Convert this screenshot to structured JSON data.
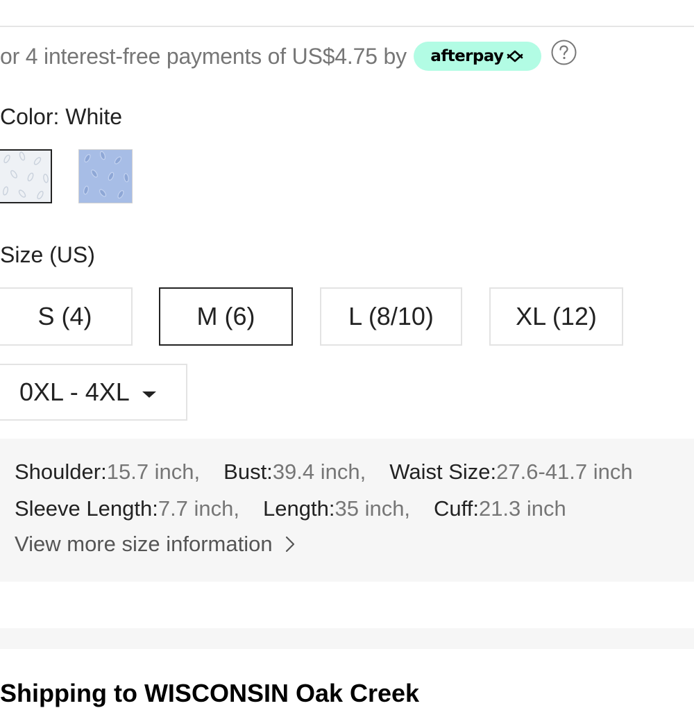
{
  "payment": {
    "installment_text": "or 4 interest-free payments of US$4.75 by",
    "provider_label": "afterpay",
    "provider_color": "#b2fce4",
    "help_icon": "question-circle-icon"
  },
  "color": {
    "label": "Color: White",
    "swatches": [
      {
        "name": "White",
        "selected": true,
        "color": "#f2f4f7"
      },
      {
        "name": "Blue",
        "selected": false,
        "color": "#a9bfe8"
      }
    ]
  },
  "size": {
    "label": "Size (US)",
    "options": [
      {
        "label": "S (4)",
        "selected": false
      },
      {
        "label": "M (6)",
        "selected": true
      },
      {
        "label": "L (8/10)",
        "selected": false
      },
      {
        "label": "XL (12)",
        "selected": false
      }
    ],
    "extended_dropdown": "0XL - 4XL"
  },
  "measurements": {
    "shoulder_key": "Shoulder:",
    "shoulder_val": "15.7 inch,",
    "bust_key": "Bust:",
    "bust_val": "39.4 inch,",
    "waist_key": "Waist Size:",
    "waist_val": "27.6-41.7 inch",
    "sleeve_key": "Sleeve Length:",
    "sleeve_val": "7.7 inch,",
    "length_key": "Length:",
    "length_val": "35 inch,",
    "cuff_key": "Cuff:",
    "cuff_val": "21.3 inch",
    "more_link": "View more size information"
  },
  "shipping": {
    "heading": "Shipping to WISCONSIN Oak Creek"
  }
}
